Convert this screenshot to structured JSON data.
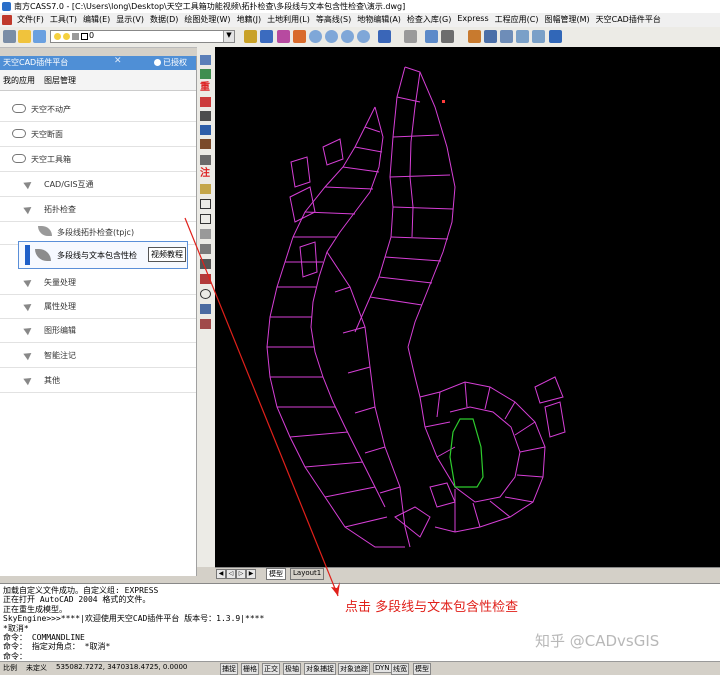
{
  "window": {
    "title": "南方CASS7.0 - [C:\\Users\\long\\Desktop\\天空工具箱功能视频\\拓扑检查\\多段线与文本包含性检查\\演示.dwg]"
  },
  "menu": [
    "文件(F)",
    "工具(T)",
    "编辑(E)",
    "显示(V)",
    "数据(D)",
    "绘图处理(W)",
    "地籍(J)",
    "土地利用(L)",
    "等高线(S)",
    "地物编辑(A)",
    "检查入库(G)",
    "Express",
    "工程应用(C)",
    "图幅管理(M)",
    "天空CAD插件平台"
  ],
  "toolbar": {
    "layer_value": "0"
  },
  "panel": {
    "title": "天空CAD插件平台",
    "auth_label": "已授权",
    "tabs": [
      "我的应用",
      "图层管理"
    ],
    "items": [
      {
        "label": "天空不动产",
        "icon": "cloud-icon"
      },
      {
        "label": "天空断面",
        "icon": "cloud-icon"
      },
      {
        "label": "天空工具箱",
        "icon": "cloud-icon"
      },
      {
        "label": "CAD/GIS互通",
        "icon": "arrow-icon"
      },
      {
        "label": "拓扑检查",
        "icon": "arrow-icon"
      },
      {
        "label": "多段线拓扑检查(tpjc)",
        "icon": "leaf-icon"
      },
      {
        "label": "矢量处理",
        "icon": "arrow-icon"
      },
      {
        "label": "属性处理",
        "icon": "arrow-icon"
      },
      {
        "label": "图形编辑",
        "icon": "arrow-icon"
      },
      {
        "label": "智能注记",
        "icon": "arrow-icon"
      },
      {
        "label": "其他",
        "icon": "arrow-icon"
      }
    ],
    "selected_item": {
      "label": "多段线与文本包含性检",
      "tooltip": "视频教程"
    }
  },
  "layout_tabs": [
    "模型",
    "Layout1"
  ],
  "command_lines": [
    "加载自定义文件成功。自定义组: EXPRESS",
    "正在打开 AutoCAD 2004 格式的文件。",
    "正在重生成模型。",
    "SkyEngine>>>****|欢迎使用天空CAD插件平台 版本号：1.3.9|****",
    "*取消*",
    "命令： COMMANDLINE",
    "命令： 指定对角点： *取消*",
    "命令："
  ],
  "annotation": "点击 多段线与文本包含性检查",
  "watermark": "知乎 @CADvsGIS",
  "status": {
    "scale_label": "比例",
    "scale_value": "未定义",
    "coords": "535082.7272, 3470318.4725, 0.0000",
    "buttons": [
      "捕捉",
      "栅格",
      "正交",
      "极轴",
      "对象捕捉",
      "对象追踪",
      "DYN",
      "线宽",
      "模型"
    ]
  },
  "colors": {
    "parcel_lines": "#d63fd6",
    "highlight_parcel": "#2ecc2e",
    "annotation": "#e0201a",
    "panel_header": "#4f8fd6",
    "canvas": "#000000"
  }
}
